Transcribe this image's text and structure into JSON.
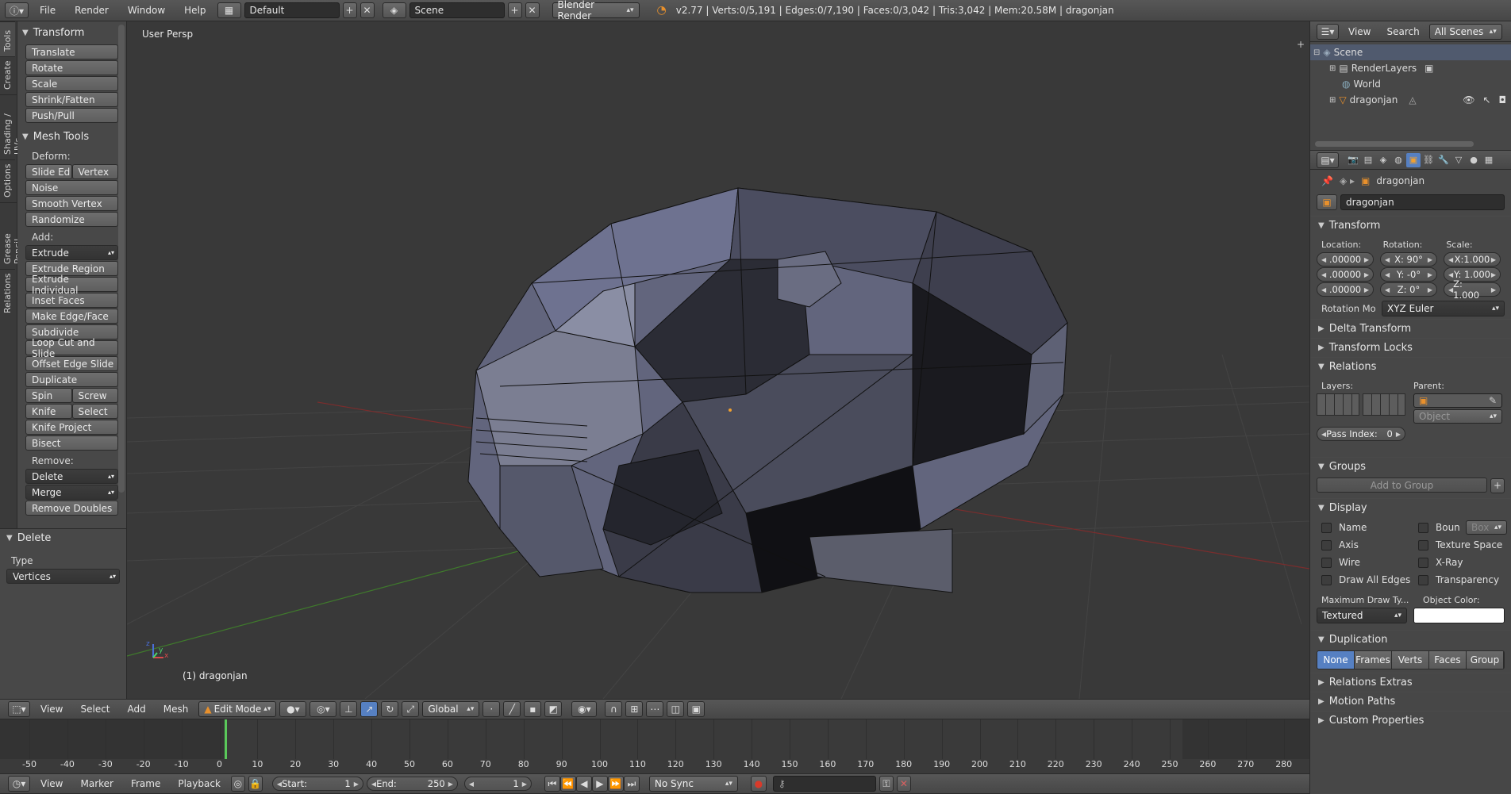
{
  "topbar": {
    "menus": [
      "File",
      "Render",
      "Window",
      "Help"
    ],
    "layout": "Default",
    "scene": "Scene",
    "engine": "Blender Render",
    "stats": "v2.77 | Verts:0/5,191 | Edges:0/7,190 | Faces:0/3,042 | Tris:3,042 | Mem:20.58M | dragonjan"
  },
  "toolshelf": {
    "tabs": [
      "Tools",
      "Create",
      "Shading / UVs",
      "Options",
      "Grease Pencil",
      "Relations"
    ],
    "transform_title": "Transform",
    "transform": [
      "Translate",
      "Rotate",
      "Scale",
      "Shrink/Fatten",
      "Push/Pull"
    ],
    "mesh_title": "Mesh Tools",
    "deform_label": "Deform:",
    "slide_edge": "Slide Ed",
    "vertex": "Vertex",
    "deform": [
      "Noise",
      "Smooth Vertex",
      "Randomize"
    ],
    "add_label": "Add:",
    "extrude": "Extrude",
    "add": [
      "Extrude Region",
      "Extrude Individual",
      "Inset Faces",
      "Make Edge/Face",
      "Subdivide",
      "Loop Cut and Slide",
      "Offset Edge Slide",
      "Duplicate"
    ],
    "spin": "Spin",
    "screw": "Screw",
    "knife": "Knife",
    "select": "Select",
    "knife_project": "Knife Project",
    "bisect": "Bisect",
    "remove_label": "Remove:",
    "delete": "Delete",
    "merge": "Merge",
    "remove_doubles": "Remove Doubles",
    "op_title": "Delete",
    "type_label": "Type",
    "type_value": "Vertices"
  },
  "viewport": {
    "view_name": "User Persp",
    "object_label": "(1) dragonjan",
    "axis_x": "x",
    "axis_y": "y",
    "axis_z": "z"
  },
  "view3d_header": {
    "menus": [
      "View",
      "Select",
      "Add",
      "Mesh"
    ],
    "mode": "Edit Mode",
    "orientation": "Global"
  },
  "timeline": {
    "ticks": [
      "-50",
      "-40",
      "-30",
      "-20",
      "-10",
      "0",
      "10",
      "20",
      "30",
      "40",
      "50",
      "60",
      "70",
      "80",
      "90",
      "100",
      "110",
      "120",
      "130",
      "140",
      "150",
      "160",
      "170",
      "180",
      "190",
      "200",
      "210",
      "220",
      "230",
      "240",
      "250",
      "260",
      "270",
      "280"
    ],
    "current_frame_marker": 0,
    "menus": [
      "View",
      "Marker",
      "Frame",
      "Playback"
    ],
    "start_label": "Start:",
    "start": "1",
    "end_label": "End:",
    "end": "250",
    "frame": "1",
    "sync": "No Sync"
  },
  "outliner": {
    "menus": [
      "View",
      "Search"
    ],
    "filter": "All Scenes",
    "items": [
      {
        "name": "Scene"
      },
      {
        "name": "RenderLayers"
      },
      {
        "name": "World"
      },
      {
        "name": "dragonjan"
      }
    ]
  },
  "properties": {
    "object_name": "dragonjan",
    "name_field": "dragonjan",
    "transform_title": "Transform",
    "location_label": "Location:",
    "rotation_label": "Rotation:",
    "scale_label": "Scale:",
    "location": [
      ".00000",
      ".00000",
      ".00000"
    ],
    "rotation": [
      "X:    90°",
      "Y:     -0°",
      "Z:      0°"
    ],
    "scale": [
      "X:1.000",
      "Y: 1.000",
      "Z: 1.000"
    ],
    "rotation_mode_label": "Rotation Mo",
    "rotation_mode": "XYZ Euler",
    "delta_title": "Delta Transform",
    "locks_title": "Transform Locks",
    "relations_title": "Relations",
    "layers_label": "Layers:",
    "parent_label": "Parent:",
    "parent_type": "Object",
    "pass_index_label": "Pass Index:",
    "pass_index": "0",
    "groups_title": "Groups",
    "add_group": "Add to Group",
    "display_title": "Display",
    "display_left": [
      "Name",
      "Axis",
      "Wire",
      "Draw All Edges"
    ],
    "display_right": [
      "Boun",
      "Texture Space",
      "X-Ray",
      "Transparency"
    ],
    "bounds_type": "Box",
    "max_draw_label": "Maximum Draw Ty...",
    "object_color_label": "Object Color:",
    "max_draw": "Textured",
    "dup_title": "Duplication",
    "dup": [
      "None",
      "Frames",
      "Verts",
      "Faces",
      "Group"
    ],
    "relations_extras": "Relations Extras",
    "motion_paths": "Motion Paths",
    "custom_props": "Custom Properties"
  }
}
